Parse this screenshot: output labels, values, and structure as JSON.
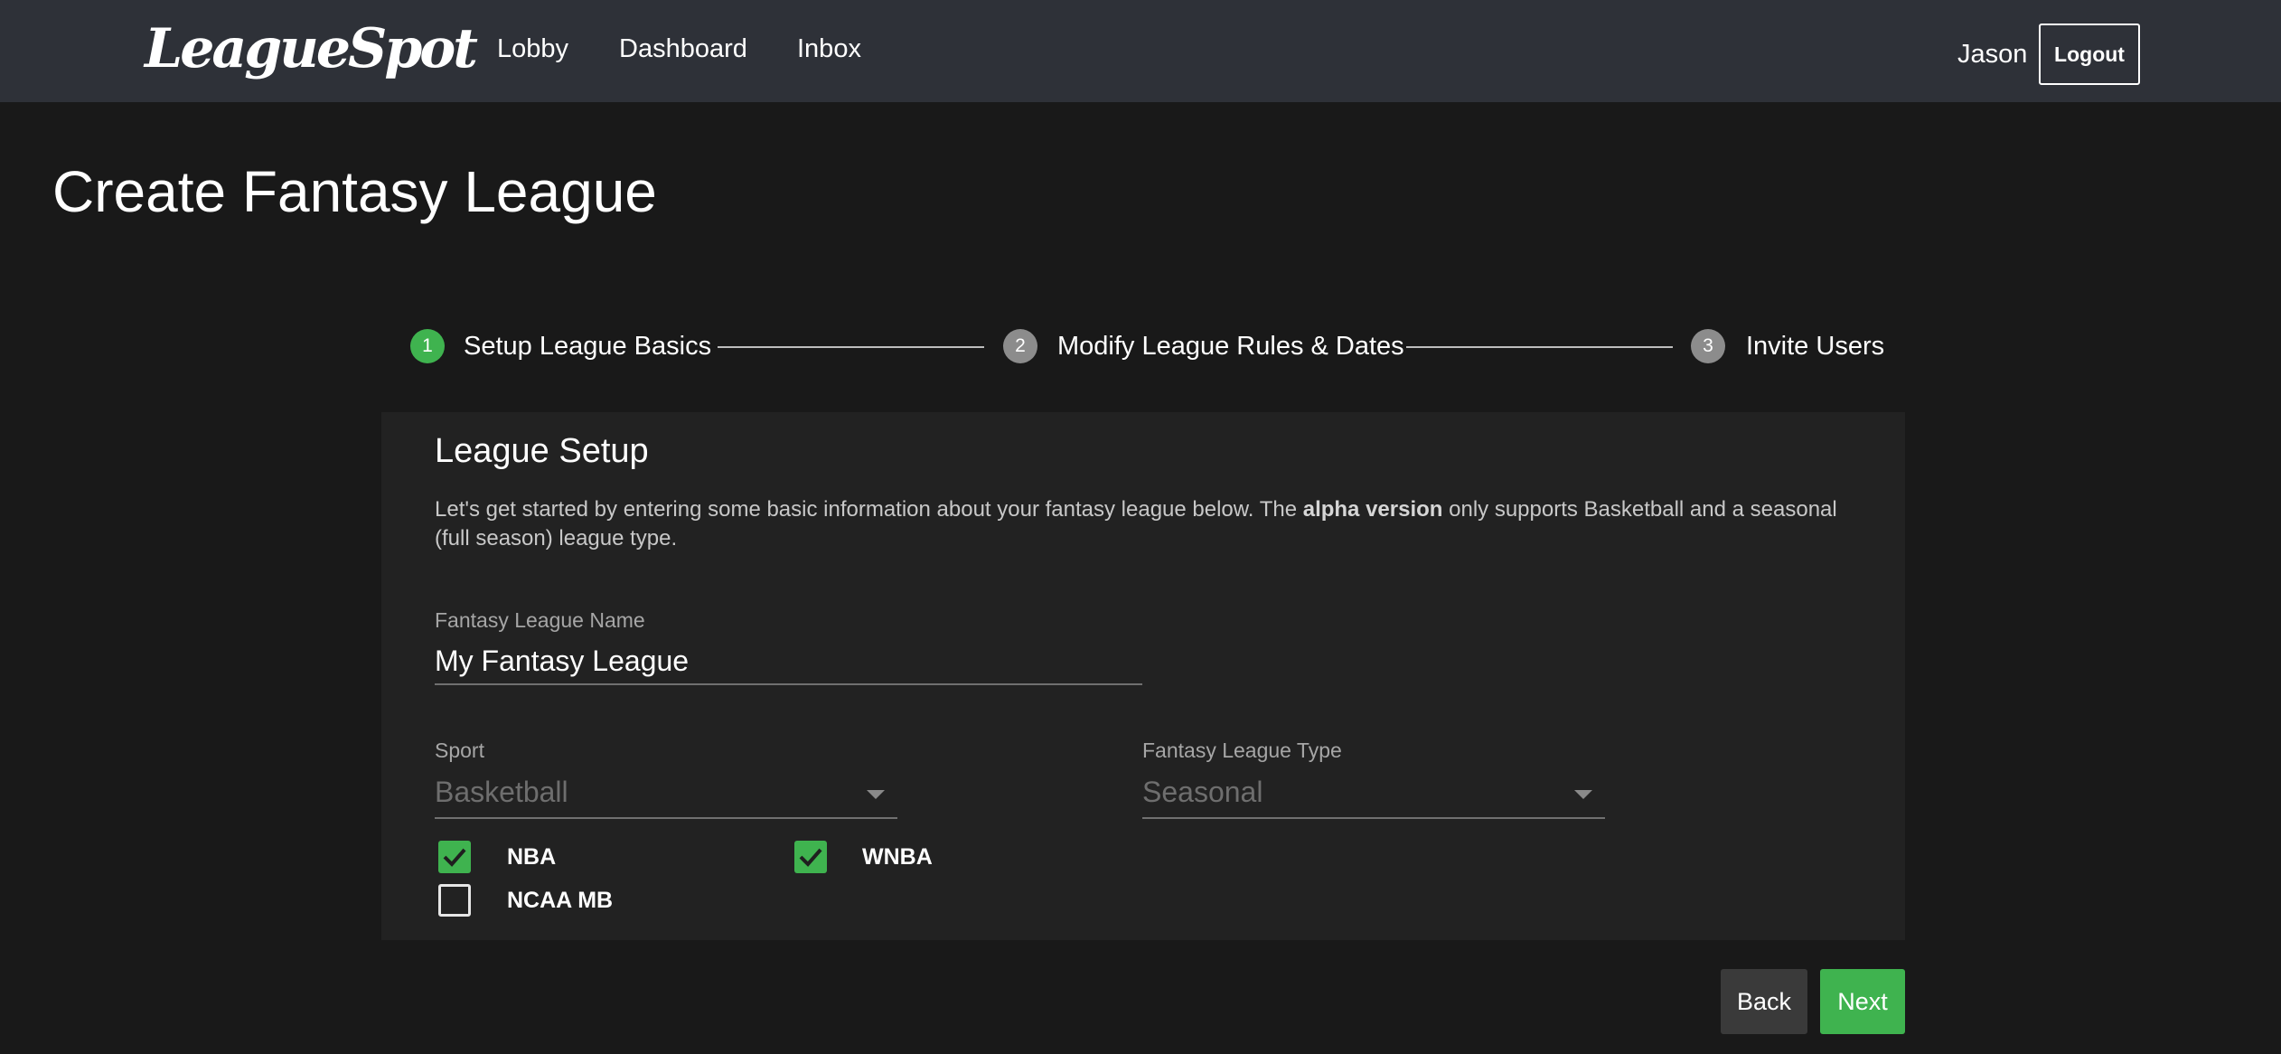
{
  "navbar": {
    "logo": "LeagueSpot",
    "links": [
      "Lobby",
      "Dashboard",
      "Inbox"
    ],
    "user": "Jason",
    "logout_label": "Logout"
  },
  "page": {
    "title": "Create Fantasy League"
  },
  "stepper": {
    "steps": [
      {
        "number": "1",
        "label": "Setup League Basics",
        "active": true
      },
      {
        "number": "2",
        "label": "Modify League Rules & Dates",
        "active": false
      },
      {
        "number": "3",
        "label": "Invite Users",
        "active": false
      }
    ],
    "active_color": "#3fb34f",
    "inactive_color": "#8c8c8c"
  },
  "setup": {
    "title": "League Setup",
    "desc_before": "Let's get started by entering some basic information about your fantasy league below. The ",
    "desc_bold": "alpha version",
    "desc_after": " only supports Basketball and a seasonal (full season) league type.",
    "name_label": "Fantasy League Name",
    "name_value": "My Fantasy League",
    "sport_label": "Sport",
    "sport_value": "Basketball",
    "type_label": "Fantasy League Type",
    "type_value": "Seasonal",
    "checkboxes": [
      {
        "label": "NBA",
        "checked": true
      },
      {
        "label": "WNBA",
        "checked": true
      },
      {
        "label": "NCAA MB",
        "checked": false
      }
    ]
  },
  "footer": {
    "back_label": "Back",
    "next_label": "Next"
  },
  "colors": {
    "navbar_bg": "#2e3138",
    "page_bg": "#191919",
    "card_bg": "#222222",
    "accent": "#3fb34f"
  }
}
